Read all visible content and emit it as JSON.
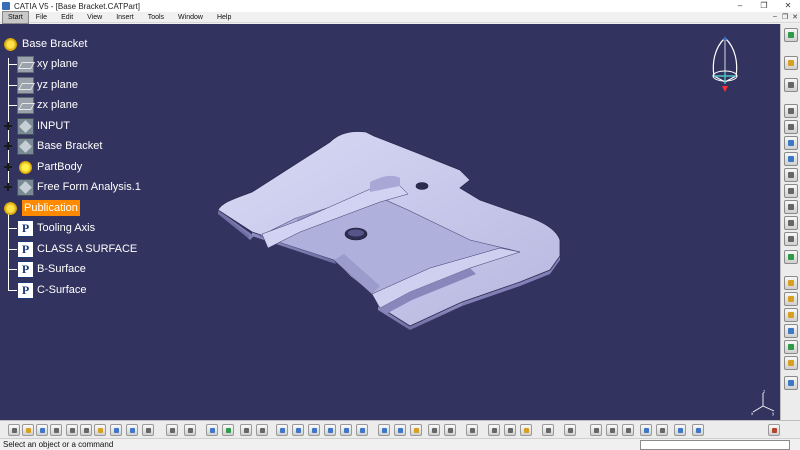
{
  "window": {
    "title": "CATIA V5 - [Base Bracket.CATPart]",
    "controls": [
      "–",
      "❐",
      "✕"
    ]
  },
  "menubar": {
    "items": [
      "Start",
      "File",
      "Edit",
      "View",
      "Insert",
      "Tools",
      "Window",
      "Help"
    ],
    "doc_controls": [
      "–",
      "❐",
      "✕"
    ]
  },
  "tree": {
    "root": "Base Bracket",
    "nodes": [
      {
        "label": "xy plane",
        "icon": "plane-icon"
      },
      {
        "label": "yz plane",
        "icon": "plane-icon"
      },
      {
        "label": "zx plane",
        "icon": "plane-icon"
      },
      {
        "label": "INPUT",
        "icon": "geometrical-set-icon"
      },
      {
        "label": "Base Bracket",
        "icon": "geometrical-set-icon"
      },
      {
        "label": "PartBody",
        "icon": "part-body-icon"
      },
      {
        "label": "Free Form Analysis.1",
        "icon": "analysis-icon"
      },
      {
        "label": "Publication",
        "icon": "publication-icon"
      },
      {
        "label": "Tooling Axis",
        "icon": "publication-item-icon"
      },
      {
        "label": "CLASS A SURFACE",
        "icon": "publication-item-icon"
      },
      {
        "label": "B-Surface",
        "icon": "publication-item-icon"
      },
      {
        "label": "C-Surface",
        "icon": "publication-item-icon"
      }
    ]
  },
  "viewport": {
    "background": "#33335f",
    "part_color": "#c9c9ee",
    "highlight_color": "#ff8a00"
  },
  "status": {
    "text": "Select an object or a command",
    "command_value": ""
  }
}
